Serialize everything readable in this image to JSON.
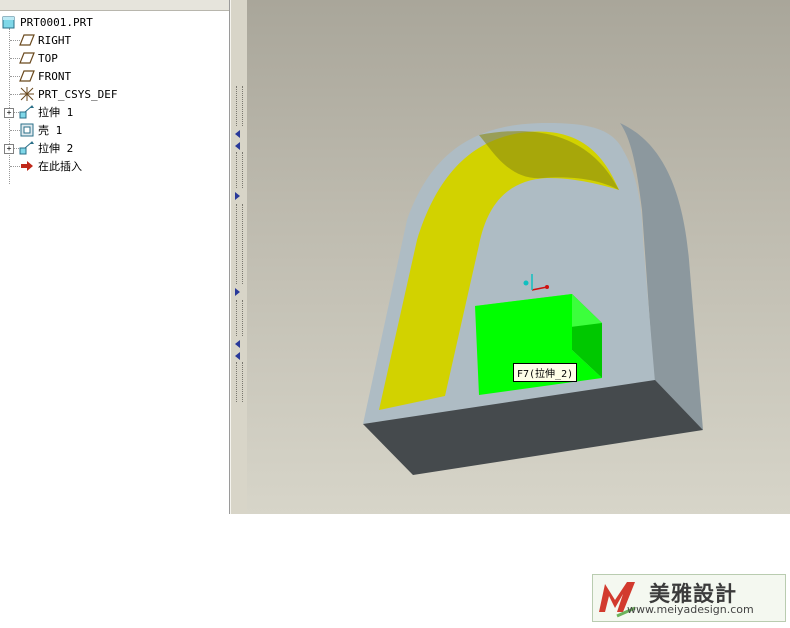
{
  "model_tree": {
    "items": [
      {
        "label": "PRT0001.PRT",
        "icon": "part-icon"
      },
      {
        "label": "RIGHT",
        "icon": "datum-plane-icon"
      },
      {
        "label": "TOP",
        "icon": "datum-plane-icon"
      },
      {
        "label": "FRONT",
        "icon": "datum-plane-icon"
      },
      {
        "label": "PRT_CSYS_DEF",
        "icon": "coordinate-system-icon"
      },
      {
        "label": "拉伸 1",
        "icon": "extrude-icon"
      },
      {
        "label": "壳 1",
        "icon": "shell-icon"
      },
      {
        "label": "拉伸 2",
        "icon": "extrude-icon"
      },
      {
        "label": "在此插入",
        "icon": "insert-here-arrow-icon"
      }
    ]
  },
  "viewport": {
    "tooltip": "F7(拉伸_2)",
    "colors": {
      "body_face": "#aebcc4",
      "side_face": "#8c989e",
      "bottom_face": "#454a4d",
      "inner_surface": "#d2d200",
      "highlight": "#00ff00"
    }
  },
  "watermark": {
    "brand": "美雅設計",
    "url": "www.meiyadesign.com"
  }
}
